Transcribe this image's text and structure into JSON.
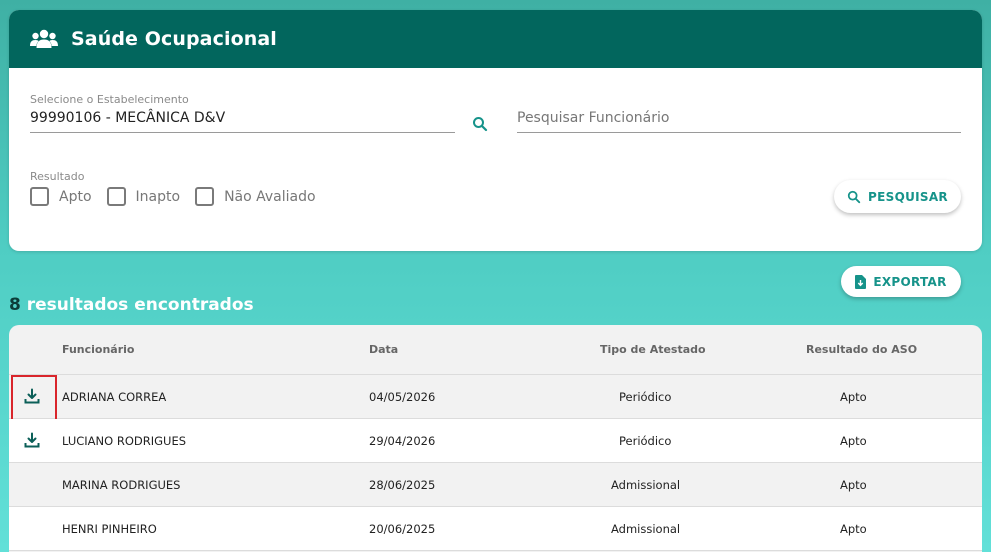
{
  "header": {
    "title": "Saúde Ocupacional",
    "icon": "users-icon"
  },
  "filters": {
    "establishment_label": "Selecione o Estabelecimento",
    "establishment_value": "99990106 - MECÂNICA D&V",
    "employee_placeholder": "Pesquisar Funcionário",
    "result_label": "Resultado",
    "options": [
      "Apto",
      "Inapto",
      "Não Avaliado"
    ],
    "search_button": "PESQUISAR"
  },
  "export_button": "EXPORTAR",
  "results": {
    "count": "8",
    "text": "resultados encontrados"
  },
  "table": {
    "columns": [
      "Funcionário",
      "Data",
      "Tipo de Atestado",
      "Resultado do ASO"
    ],
    "rows": [
      {
        "name": "ADRIANA CORREA",
        "date": "04/05/2026",
        "type": "Periódico",
        "result": "Apto"
      },
      {
        "name": "LUCIANO RODRIGUES",
        "date": "29/04/2026",
        "type": "Periódico",
        "result": "Apto"
      },
      {
        "name": "MARINA RODRIGUES",
        "date": "28/06/2025",
        "type": "Admissional",
        "result": "Apto"
      },
      {
        "name": "HENRI PINHEIRO",
        "date": "20/06/2025",
        "type": "Admissional",
        "result": "Apto"
      }
    ]
  },
  "colors": {
    "header": "#02665d",
    "accent": "#16938a",
    "highlight": "#d9252b"
  }
}
